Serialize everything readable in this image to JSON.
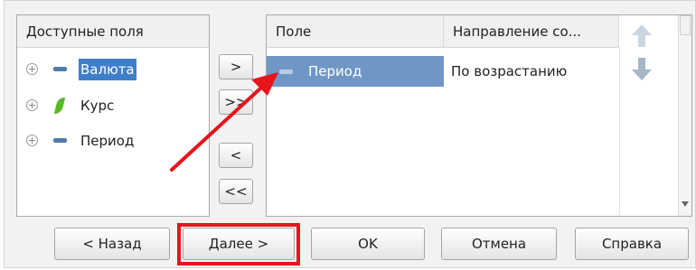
{
  "available_fields": {
    "header": "Доступные поля",
    "items": [
      {
        "label": "Валюта",
        "icon": "dimension-icon",
        "selected": true
      },
      {
        "label": "Курс",
        "icon": "resource-icon",
        "selected": false
      },
      {
        "label": "Период",
        "icon": "dimension-icon",
        "selected": false
      }
    ]
  },
  "transfer": {
    "add": ">",
    "add_all": ">>",
    "remove": "<",
    "remove_all": "<<"
  },
  "order_table": {
    "columns": [
      "Поле",
      "Направление со..."
    ],
    "rows": [
      {
        "field": "Период",
        "direction": "По возрастанию"
      }
    ]
  },
  "footer": {
    "back": "< Назад",
    "next": "Далее >",
    "ok": "OK",
    "cancel": "Отмена",
    "help": "Справка"
  },
  "annotation": {
    "color": "#e8141c"
  }
}
